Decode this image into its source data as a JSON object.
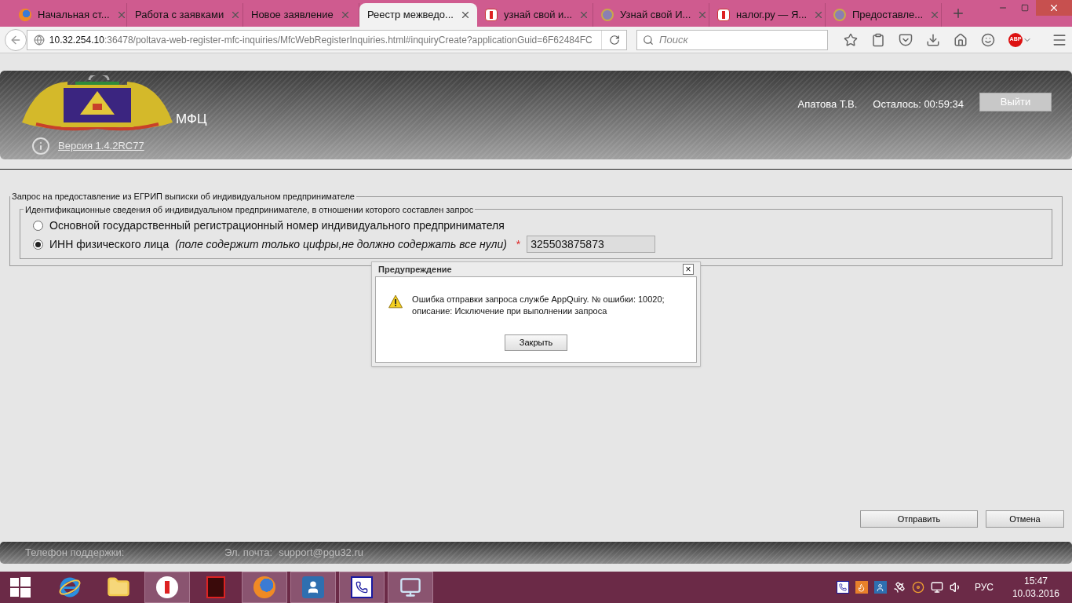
{
  "browser": {
    "tabs": [
      {
        "label": "Начальная ст...",
        "kind": "firefox",
        "selected": false
      },
      {
        "label": "Работа с заявками",
        "kind": "plain",
        "selected": false
      },
      {
        "label": "Новое заявление",
        "kind": "plain",
        "selected": false
      },
      {
        "label": "Реестр межведо...",
        "kind": "plain",
        "selected": true
      },
      {
        "label": "узнай свой и...",
        "kind": "yandex",
        "selected": false
      },
      {
        "label": "Узнай свой И...",
        "kind": "emblem",
        "selected": false
      },
      {
        "label": "налог.ру — Я...",
        "kind": "yandex",
        "selected": false
      },
      {
        "label": "Предоставле...",
        "kind": "emblem",
        "selected": false
      }
    ],
    "url_host": "10.32.254.10",
    "url_rest": ":36478/poltava-web-register-mfc-inquiries/MfcWebRegisterInquiries.html#inquiryCreate?applicationGuid=6F62484FC",
    "search_placeholder": "Поиск",
    "adblock": "ABP"
  },
  "header": {
    "title": "МФЦ",
    "version": "Версия 1.4.2RC77",
    "user": "Апатова Т.В.",
    "timer": "Осталось: 00:59:34",
    "logout": "Выйти"
  },
  "form": {
    "legend": "Запрос на предоставление из ЕГРИП выписки об индивидуальном предпринимателе",
    "inner_legend": "Идентификационные сведения об индивидуальном предпринимателе, в отношении которого составлен запрос",
    "options": [
      {
        "label": "Основной государственный регистрационный номер индивидуального предпринимателя",
        "selected": false
      },
      {
        "label": "ИНН физического лица",
        "hint": "(поле содержит только цифры,не должно содержать все нули)",
        "required": "*",
        "value": "325503875873",
        "selected": true
      }
    ]
  },
  "dialog": {
    "title": "Предупреждение",
    "close": "×",
    "message": "Ошибка отправки запроса службе AppQuiry. № ошибки: 10020; описание: Исключение при выполнении запроса",
    "button": "Закрыть"
  },
  "actions": [
    "Отправить",
    "Отмена"
  ],
  "footer": {
    "phone": "Телефон поддержки:",
    "email_label": "Эл. почта:",
    "email": "support@pgu32.ru"
  },
  "taskbar": {
    "apps": [
      {
        "kind": "ie",
        "active": false
      },
      {
        "kind": "explorer",
        "active": false
      },
      {
        "kind": "yandex",
        "active": true
      },
      {
        "kind": "pdf",
        "active": false
      },
      {
        "kind": "firefox",
        "active": true
      },
      {
        "kind": "contact",
        "active": true
      },
      {
        "kind": "phone",
        "active": true
      },
      {
        "kind": "monitor",
        "active": true
      }
    ],
    "tray": [
      {
        "kind": "phone"
      },
      {
        "kind": "java"
      },
      {
        "kind": "contact"
      },
      {
        "kind": "satellite"
      },
      {
        "kind": "disc"
      },
      {
        "kind": "network"
      },
      {
        "kind": "volume"
      }
    ],
    "lang": "РУС",
    "time": "15:47",
    "date": "10.03.2016"
  }
}
